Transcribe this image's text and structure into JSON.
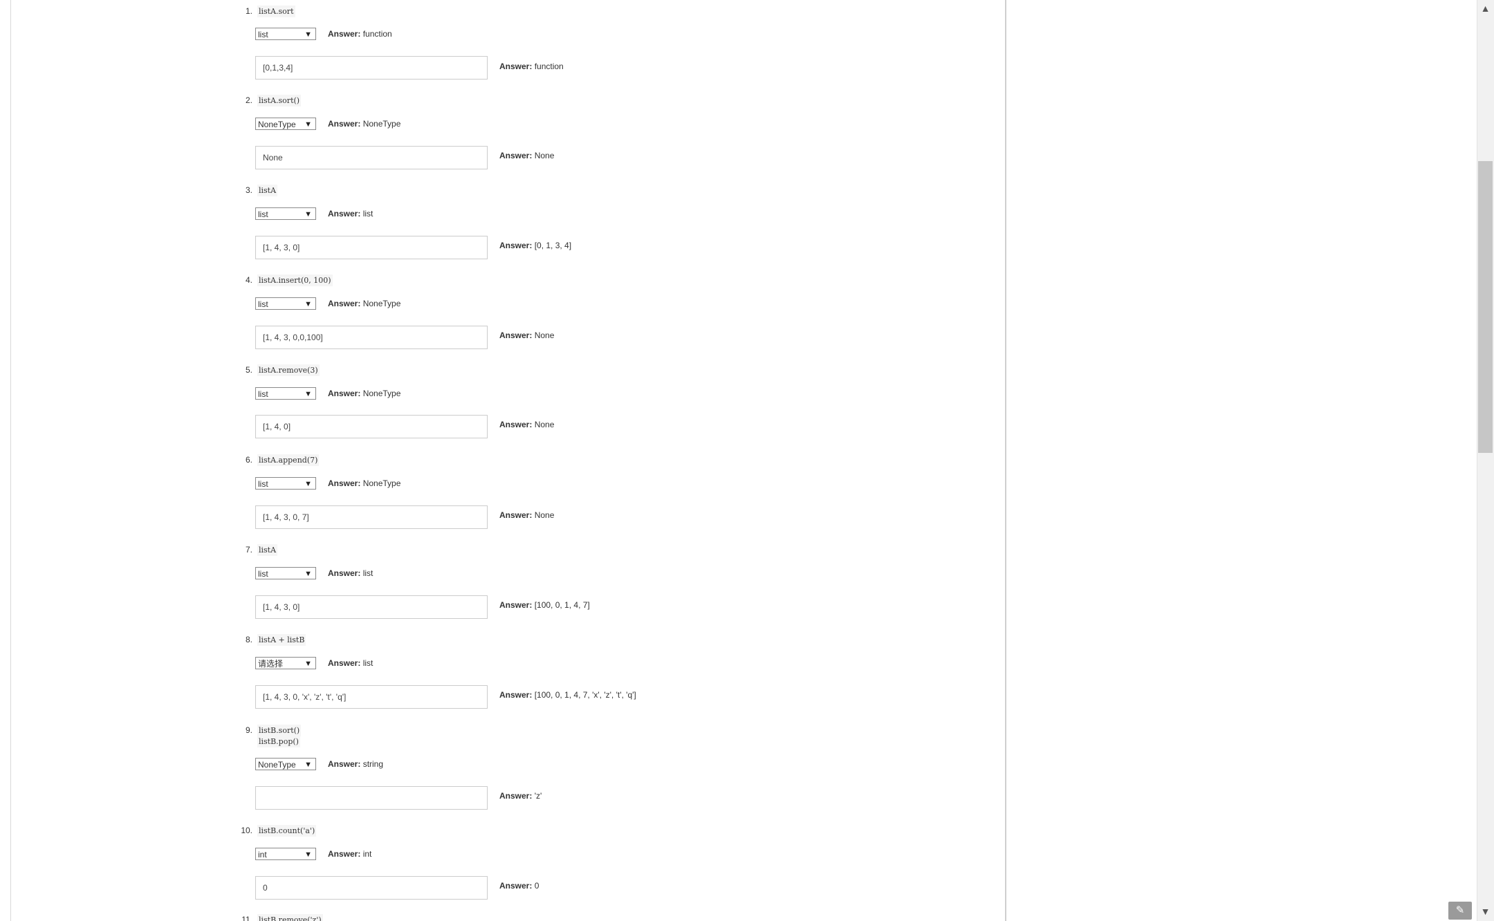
{
  "answer_label": "Answer:",
  "questions": [
    {
      "num": "1.",
      "code": [
        "listA.sort"
      ],
      "type_selected": "list",
      "type_answer": "function",
      "value_input": "[0,1,3,4]",
      "value_answer": "function"
    },
    {
      "num": "2.",
      "code": [
        "listA.sort()"
      ],
      "type_selected": "NoneType",
      "type_answer": "NoneType",
      "value_input": "None",
      "value_answer": "None"
    },
    {
      "num": "3.",
      "code": [
        "listA"
      ],
      "type_selected": "list",
      "type_answer": "list",
      "value_input": "[1, 4, 3, 0]",
      "value_answer": "[0, 1, 3, 4]"
    },
    {
      "num": "4.",
      "code": [
        "listA.insert(0, 100)"
      ],
      "type_selected": "list",
      "type_answer": "NoneType",
      "value_input": "[1, 4, 3, 0,0,100]",
      "value_answer": "None"
    },
    {
      "num": "5.",
      "code": [
        "listA.remove(3)"
      ],
      "type_selected": "list",
      "type_answer": "NoneType",
      "value_input": "[1, 4, 0]",
      "value_answer": "None"
    },
    {
      "num": "6.",
      "code": [
        "listA.append(7)"
      ],
      "type_selected": "list",
      "type_answer": "NoneType",
      "value_input": "[1, 4, 3, 0, 7]",
      "value_answer": "None"
    },
    {
      "num": "7.",
      "code": [
        "listA"
      ],
      "type_selected": "list",
      "type_answer": "list",
      "value_input": "[1, 4, 3, 0]",
      "value_answer": "[100, 0, 1, 4, 7]"
    },
    {
      "num": "8.",
      "code": [
        "listA + listB"
      ],
      "type_selected": "请选择",
      "type_answer": "list",
      "value_input": "[1, 4, 3, 0, 'x', 'z', 't', 'q']",
      "value_answer": "[100, 0, 1, 4, 7, 'x', 'z', 't', 'q']"
    },
    {
      "num": "9.",
      "code": [
        "listB.sort()",
        "listB.pop()"
      ],
      "type_selected": "NoneType",
      "type_answer": "string",
      "value_input": "",
      "value_answer": "'z'"
    },
    {
      "num": "10.",
      "code": [
        "listB.count('a')"
      ],
      "type_selected": "int",
      "type_answer": "int",
      "value_input": "0",
      "value_answer": "0"
    },
    {
      "num": "11.",
      "code": [
        "listB.remove('z')"
      ]
    }
  ],
  "icons": {
    "edit": "pencil-icon",
    "scroll_up": "arrow-up-icon",
    "scroll_down": "arrow-down-icon"
  }
}
